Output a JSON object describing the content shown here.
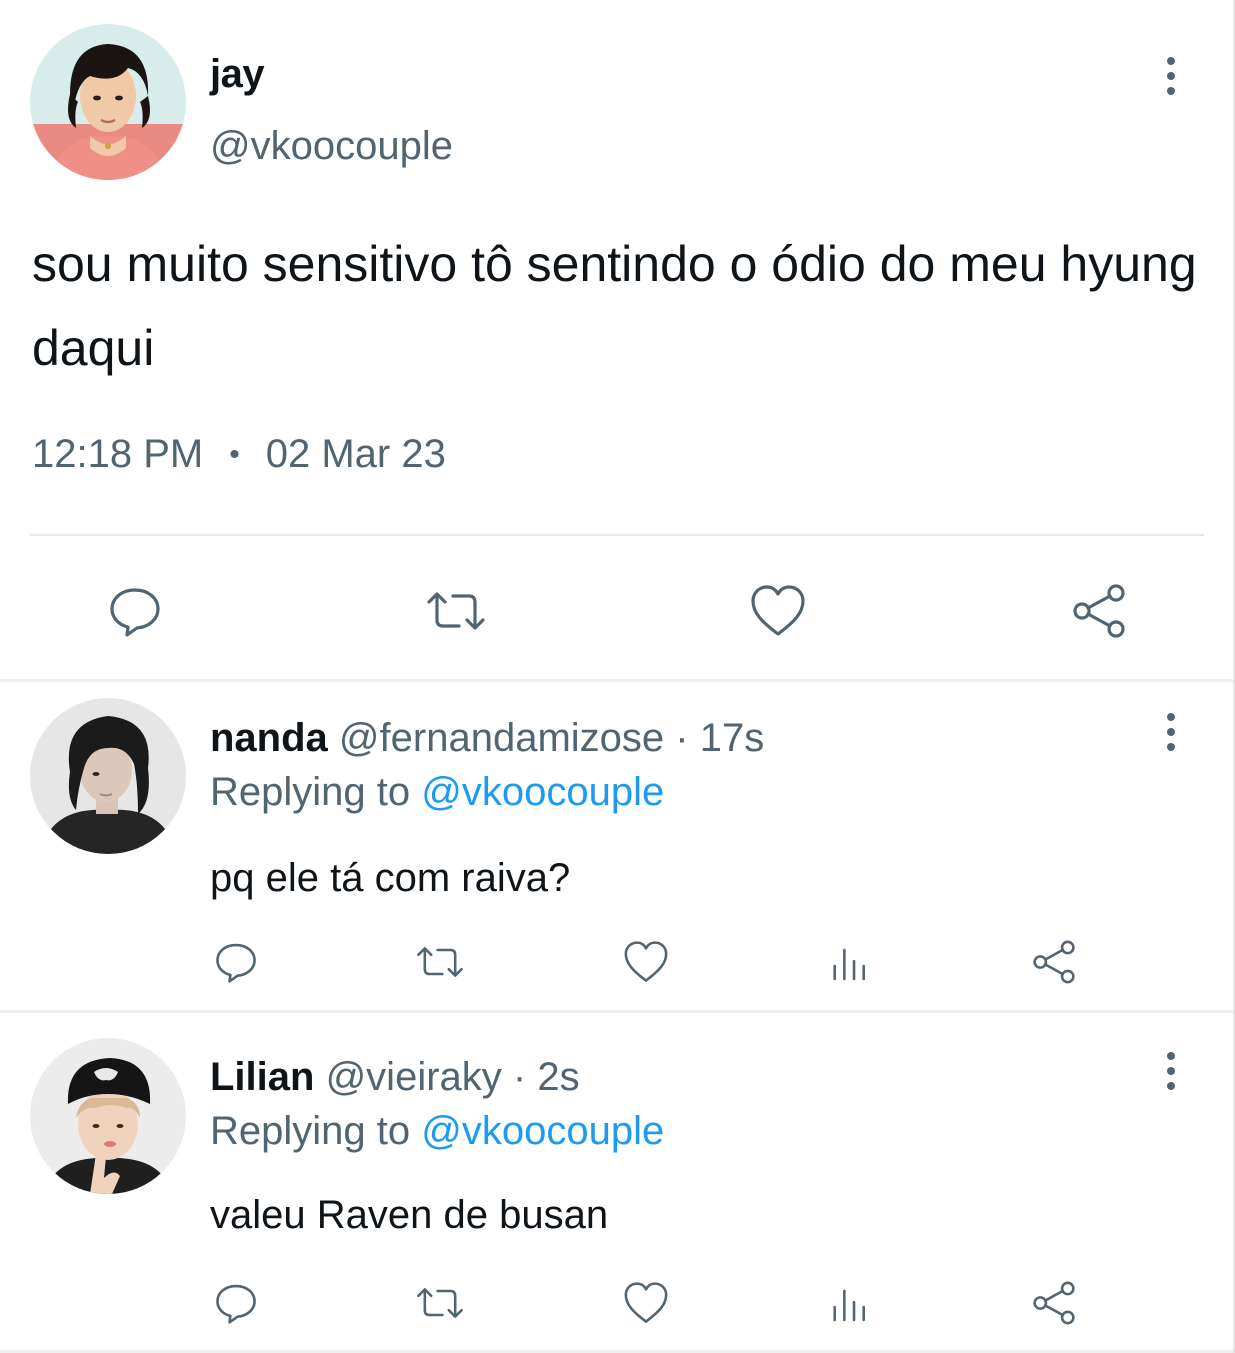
{
  "main_tweet": {
    "name": "jay",
    "handle": "@vkoocouple",
    "text": "sou muito sensitivo tô sentindo o ódio do meu hyung daqui",
    "time": "12:18 PM",
    "separator": "•",
    "date": "02 Mar 23",
    "actions": [
      "reply-icon",
      "retweet-icon",
      "like-icon",
      "share-icon"
    ]
  },
  "replies": [
    {
      "name": "nanda",
      "handle": "@fernandamizose",
      "separator": "·",
      "time": "17s",
      "replying_label": "Replying to",
      "replying_to": "@vkoocouple",
      "text": "pq ele tá com raiva?",
      "actions": [
        "reply-icon",
        "retweet-icon",
        "like-icon",
        "views-icon",
        "share-icon"
      ]
    },
    {
      "name": "Lilian",
      "handle": "@vieiraky",
      "separator": "·",
      "time": "2s",
      "replying_label": "Replying to",
      "replying_to": "@vkoocouple",
      "text": "valeu Raven de busan",
      "actions": [
        "reply-icon",
        "retweet-icon",
        "like-icon",
        "views-icon",
        "share-icon"
      ]
    }
  ],
  "colors": {
    "text": "#0f1419",
    "secondary": "#536471",
    "mention": "#1d9bf0",
    "divider": "#e7e9ea"
  }
}
